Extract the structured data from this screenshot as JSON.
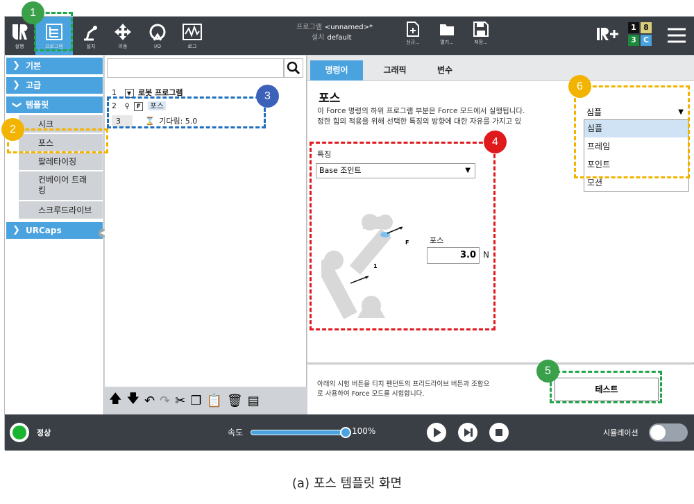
{
  "topbar": {
    "nav": [
      {
        "label": "실행",
        "icon": "ur-logo-icon"
      },
      {
        "label": "프로그램",
        "icon": "program-tree-icon"
      },
      {
        "label": "설치",
        "icon": "robot-arm-icon"
      },
      {
        "label": "이동",
        "icon": "move-arrows-icon"
      },
      {
        "label": "I/O",
        "icon": "io-icon"
      },
      {
        "label": "로그",
        "icon": "log-icon"
      }
    ],
    "program_label": "프로그램",
    "program_value": "<unnamed>*",
    "install_label": "설치",
    "install_value": "default",
    "file_buttons": [
      "신규...",
      "열기...",
      "저장..."
    ],
    "io_badges": [
      "1",
      "8",
      "3",
      "C"
    ]
  },
  "left": {
    "categories": [
      "기본",
      "고급",
      "템플릿"
    ],
    "template_items": [
      "시크",
      "포스",
      "팔레타이징",
      "컨베이어 트래킹",
      "스크루드라이브"
    ],
    "urcaps": "URCaps"
  },
  "tree": {
    "search_placeholder": "",
    "rows": [
      {
        "num": "1",
        "text": "로봇 프로그램"
      },
      {
        "num": "2",
        "text": "포스"
      },
      {
        "num": "3",
        "text": "기다림: 5.0"
      }
    ]
  },
  "right": {
    "tabs": [
      "명령어",
      "그래픽",
      "변수"
    ],
    "title": "포스",
    "desc_line1": "이 Force 명령의 하위 프로그램 부분은 Force 모드에서 실행됩니다.",
    "desc_line2": "정한 힘의 적용을 위해 선택한 특징의 방향에 대한 자유를 가지고 있",
    "feature_label": "특징",
    "feature_value": "Base 조인트",
    "force_label": "포스",
    "force_value": "3.0",
    "force_unit": "N",
    "fig_label_f": "F",
    "fig_label_1": "1",
    "mode_selected": "심플",
    "mode_options": [
      "심플",
      "프레임",
      "포인트",
      "모션"
    ]
  },
  "test": {
    "desc_line1": "아래의 시험 버튼을 티치 펜던트의 프리드라이브 버튼과 조합으",
    "desc_line2": "로 사용하여 Force 모드를 시험합니다.",
    "button": "테스트"
  },
  "footer": {
    "status": "정상",
    "speed_label": "속도",
    "speed_value": "100%",
    "speed_fraction": 1.0,
    "sim_label": "시뮬레이션"
  },
  "annotations": [
    "1",
    "2",
    "3",
    "4",
    "5",
    "6"
  ],
  "caption": "(a) 포스 템플릿 화면",
  "colors": {
    "accent": "#4aa3df",
    "dark": "#3a3f45",
    "green": "#1fa64a",
    "yellow": "#f2b400",
    "blue": "#1f6fc0",
    "red": "#e0191d"
  }
}
